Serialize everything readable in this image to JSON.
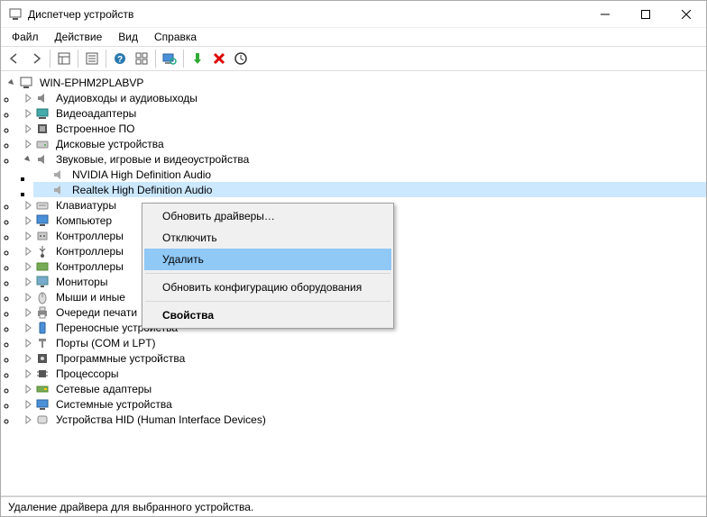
{
  "window": {
    "title": "Диспетчер устройств"
  },
  "menubar": {
    "file": "Файл",
    "action": "Действие",
    "view": "Вид",
    "help": "Справка"
  },
  "tree": {
    "root": "WIN-EPHM2PLABVP",
    "audio_inputs": "Аудиовходы и аудиовыходы",
    "video_adapters": "Видеоадаптеры",
    "firmware": "Встроенное ПО",
    "disk_devices": "Дисковые устройства",
    "sound_video_game": "Звуковые, игровые и видеоустройства",
    "nvidia_audio": "NVIDIA High Definition Audio",
    "realtek_audio": "Realtek High Definition Audio",
    "keyboards": "Клавиатуры",
    "computer": "Компьютер",
    "controllers1": "Контроллеры",
    "controllers2": "Контроллеры",
    "controllers3": "Контроллеры",
    "monitors": "Мониторы",
    "mice_other": "Мыши и иные",
    "print_queues": "Очереди печати",
    "portable_devices": "Переносные устройства",
    "ports": "Порты (COM и LPT)",
    "software_devices": "Программные устройства",
    "processors": "Процессоры",
    "network_adapters": "Сетевые адаптеры",
    "system_devices": "Системные устройства",
    "hid_devices": "Устройства HID (Human Interface Devices)"
  },
  "context_menu": {
    "update_drivers": "Обновить драйверы…",
    "disable": "Отключить",
    "delete": "Удалить",
    "scan_hardware": "Обновить конфигурацию оборудования",
    "properties": "Свойства"
  },
  "statusbar": {
    "text": "Удаление драйвера для выбранного устройства."
  }
}
